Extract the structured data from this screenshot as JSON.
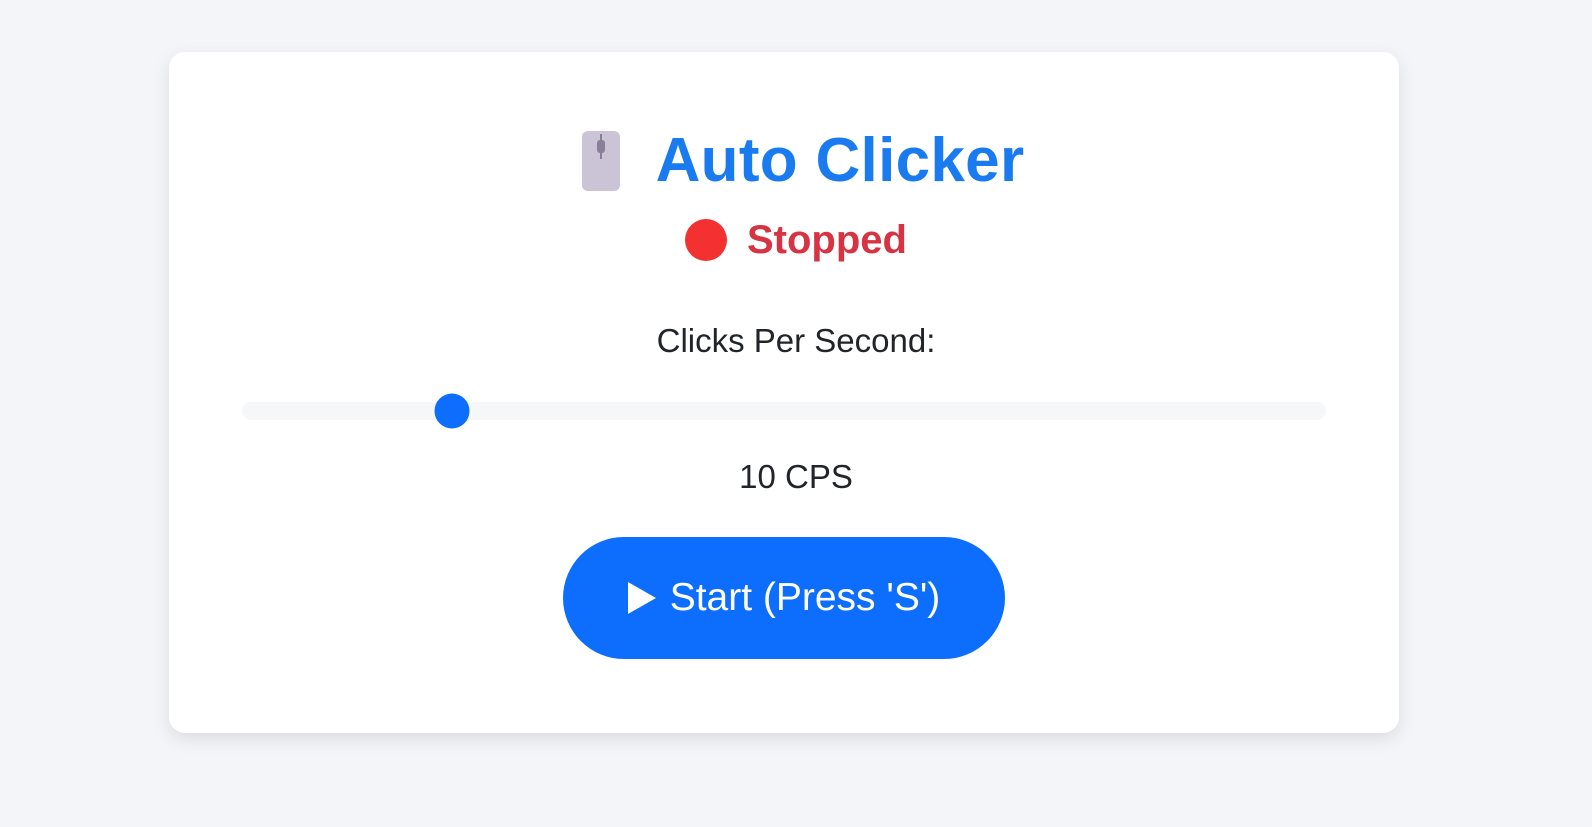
{
  "app": {
    "title": "Auto Clicker",
    "icon": "computer-mouse-icon"
  },
  "status": {
    "text": "Stopped",
    "indicator_color": "#f33131",
    "text_color": "#d63343"
  },
  "cps_control": {
    "label": "Clicks Per Second:",
    "value": 10,
    "min": 1,
    "max": 50,
    "value_display": "10 CPS"
  },
  "start_button": {
    "label": "Start (Press 'S')",
    "icon": "play-icon"
  },
  "colors": {
    "accent": "#0d6efd",
    "title": "#1a7bf0",
    "background": "#f4f5f8"
  }
}
